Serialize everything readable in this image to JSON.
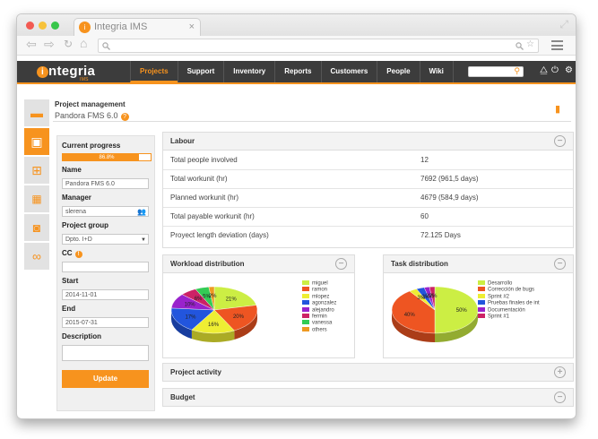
{
  "browser": {
    "tab_title": "Integria IMS",
    "tab_logo": "i",
    "close": "×",
    "back": "⇦",
    "forward": "⇨",
    "reload": "↻",
    "home": "⌂"
  },
  "brand": {
    "name": "ntegria",
    "tag": "IMS"
  },
  "nav": [
    "Projects",
    "Support",
    "Inventory",
    "Reports",
    "Customers",
    "People",
    "Wiki"
  ],
  "project": {
    "heading": "Project management",
    "name": "Pandora FMS 6.0"
  },
  "form": {
    "progress_label": "Current progress",
    "progress_text": "86.8%",
    "progress": 0.868,
    "name_label": "Name",
    "name_value": "Pandora FMS 6.0",
    "manager_label": "Manager",
    "manager_value": "slerena",
    "group_label": "Project group",
    "group_value": "Dpto. I+D",
    "cc_label": "CC",
    "start_label": "Start",
    "start_value": "2014-11-01",
    "end_label": "End",
    "end_value": "2015-07-31",
    "description_label": "Description",
    "update_label": "Update"
  },
  "labour": {
    "title": "Labour",
    "rows": [
      {
        "label": "Total people involved",
        "value": "12"
      },
      {
        "label": "Total workunit (hr)",
        "value": "7692 (961,5 days)"
      },
      {
        "label": "Planned workunit (hr)",
        "value": "4679 (584,9 days)"
      },
      {
        "label": "Total payable workunit (hr)",
        "value": "60"
      },
      {
        "label": "Proyect length deviation (days)",
        "value": "72.125 Days"
      }
    ]
  },
  "workload": {
    "title": "Workload distribution"
  },
  "tasks": {
    "title": "Task distribution"
  },
  "activity": {
    "title": "Project activity"
  },
  "budget": {
    "title": "Budget"
  },
  "colors": {
    "accent": "#f7931e",
    "nav_bg": "#3c3c3c"
  },
  "chart_data": [
    {
      "type": "pie",
      "title": "Workload distribution",
      "categories": [
        "miguel",
        "ramon",
        "mlopez",
        "agonzalez",
        "alejandro",
        "fermin",
        "vanessa",
        "others"
      ],
      "values": [
        21,
        20,
        16,
        17,
        10,
        6,
        5,
        2
      ],
      "colors": [
        "#ccee44",
        "#ee5522",
        "#eeee33",
        "#2255dd",
        "#9922cc",
        "#cc2266",
        "#33cc55",
        "#ee9922"
      ],
      "data_labels": [
        "21%",
        "20%",
        "16%",
        "17%",
        "10%",
        "6%",
        "5%",
        "2%"
      ]
    },
    {
      "type": "pie",
      "title": "Task distribution",
      "categories": [
        "Desarrollo",
        "Corrección de bugs",
        "Sprint #2",
        "Pruebas finales de int",
        "Documentación",
        "Sprint #1"
      ],
      "values": [
        50,
        40,
        3,
        3,
        2,
        2
      ],
      "colors": [
        "#ccee44",
        "#ee5522",
        "#eeee33",
        "#2255dd",
        "#9922cc",
        "#cc2266"
      ],
      "data_labels": [
        "50%",
        "40%",
        "3%",
        "3%",
        "2%",
        "2%"
      ]
    }
  ]
}
